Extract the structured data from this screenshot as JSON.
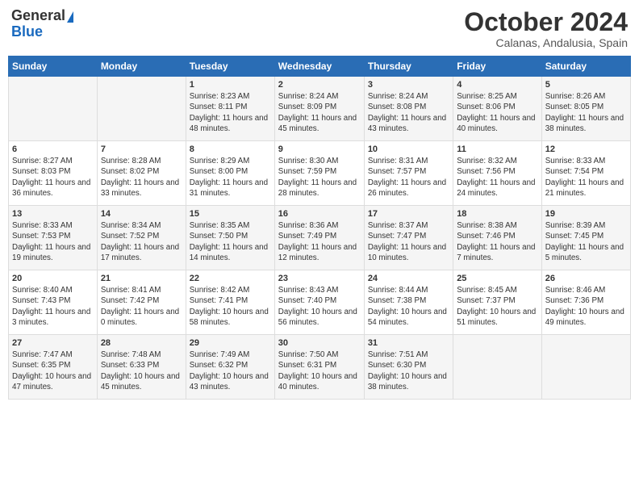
{
  "logo": {
    "general": "General",
    "blue": "Blue"
  },
  "title": "October 2024",
  "location": "Calanas, Andalusia, Spain",
  "days_of_week": [
    "Sunday",
    "Monday",
    "Tuesday",
    "Wednesday",
    "Thursday",
    "Friday",
    "Saturday"
  ],
  "weeks": [
    [
      {
        "day": "",
        "content": ""
      },
      {
        "day": "",
        "content": ""
      },
      {
        "day": "1",
        "content": "Sunrise: 8:23 AM\nSunset: 8:11 PM\nDaylight: 11 hours and 48 minutes."
      },
      {
        "day": "2",
        "content": "Sunrise: 8:24 AM\nSunset: 8:09 PM\nDaylight: 11 hours and 45 minutes."
      },
      {
        "day": "3",
        "content": "Sunrise: 8:24 AM\nSunset: 8:08 PM\nDaylight: 11 hours and 43 minutes."
      },
      {
        "day": "4",
        "content": "Sunrise: 8:25 AM\nSunset: 8:06 PM\nDaylight: 11 hours and 40 minutes."
      },
      {
        "day": "5",
        "content": "Sunrise: 8:26 AM\nSunset: 8:05 PM\nDaylight: 11 hours and 38 minutes."
      }
    ],
    [
      {
        "day": "6",
        "content": "Sunrise: 8:27 AM\nSunset: 8:03 PM\nDaylight: 11 hours and 36 minutes."
      },
      {
        "day": "7",
        "content": "Sunrise: 8:28 AM\nSunset: 8:02 PM\nDaylight: 11 hours and 33 minutes."
      },
      {
        "day": "8",
        "content": "Sunrise: 8:29 AM\nSunset: 8:00 PM\nDaylight: 11 hours and 31 minutes."
      },
      {
        "day": "9",
        "content": "Sunrise: 8:30 AM\nSunset: 7:59 PM\nDaylight: 11 hours and 28 minutes."
      },
      {
        "day": "10",
        "content": "Sunrise: 8:31 AM\nSunset: 7:57 PM\nDaylight: 11 hours and 26 minutes."
      },
      {
        "day": "11",
        "content": "Sunrise: 8:32 AM\nSunset: 7:56 PM\nDaylight: 11 hours and 24 minutes."
      },
      {
        "day": "12",
        "content": "Sunrise: 8:33 AM\nSunset: 7:54 PM\nDaylight: 11 hours and 21 minutes."
      }
    ],
    [
      {
        "day": "13",
        "content": "Sunrise: 8:33 AM\nSunset: 7:53 PM\nDaylight: 11 hours and 19 minutes."
      },
      {
        "day": "14",
        "content": "Sunrise: 8:34 AM\nSunset: 7:52 PM\nDaylight: 11 hours and 17 minutes."
      },
      {
        "day": "15",
        "content": "Sunrise: 8:35 AM\nSunset: 7:50 PM\nDaylight: 11 hours and 14 minutes."
      },
      {
        "day": "16",
        "content": "Sunrise: 8:36 AM\nSunset: 7:49 PM\nDaylight: 11 hours and 12 minutes."
      },
      {
        "day": "17",
        "content": "Sunrise: 8:37 AM\nSunset: 7:47 PM\nDaylight: 11 hours and 10 minutes."
      },
      {
        "day": "18",
        "content": "Sunrise: 8:38 AM\nSunset: 7:46 PM\nDaylight: 11 hours and 7 minutes."
      },
      {
        "day": "19",
        "content": "Sunrise: 8:39 AM\nSunset: 7:45 PM\nDaylight: 11 hours and 5 minutes."
      }
    ],
    [
      {
        "day": "20",
        "content": "Sunrise: 8:40 AM\nSunset: 7:43 PM\nDaylight: 11 hours and 3 minutes."
      },
      {
        "day": "21",
        "content": "Sunrise: 8:41 AM\nSunset: 7:42 PM\nDaylight: 11 hours and 0 minutes."
      },
      {
        "day": "22",
        "content": "Sunrise: 8:42 AM\nSunset: 7:41 PM\nDaylight: 10 hours and 58 minutes."
      },
      {
        "day": "23",
        "content": "Sunrise: 8:43 AM\nSunset: 7:40 PM\nDaylight: 10 hours and 56 minutes."
      },
      {
        "day": "24",
        "content": "Sunrise: 8:44 AM\nSunset: 7:38 PM\nDaylight: 10 hours and 54 minutes."
      },
      {
        "day": "25",
        "content": "Sunrise: 8:45 AM\nSunset: 7:37 PM\nDaylight: 10 hours and 51 minutes."
      },
      {
        "day": "26",
        "content": "Sunrise: 8:46 AM\nSunset: 7:36 PM\nDaylight: 10 hours and 49 minutes."
      }
    ],
    [
      {
        "day": "27",
        "content": "Sunrise: 7:47 AM\nSunset: 6:35 PM\nDaylight: 10 hours and 47 minutes."
      },
      {
        "day": "28",
        "content": "Sunrise: 7:48 AM\nSunset: 6:33 PM\nDaylight: 10 hours and 45 minutes."
      },
      {
        "day": "29",
        "content": "Sunrise: 7:49 AM\nSunset: 6:32 PM\nDaylight: 10 hours and 43 minutes."
      },
      {
        "day": "30",
        "content": "Sunrise: 7:50 AM\nSunset: 6:31 PM\nDaylight: 10 hours and 40 minutes."
      },
      {
        "day": "31",
        "content": "Sunrise: 7:51 AM\nSunset: 6:30 PM\nDaylight: 10 hours and 38 minutes."
      },
      {
        "day": "",
        "content": ""
      },
      {
        "day": "",
        "content": ""
      }
    ]
  ]
}
